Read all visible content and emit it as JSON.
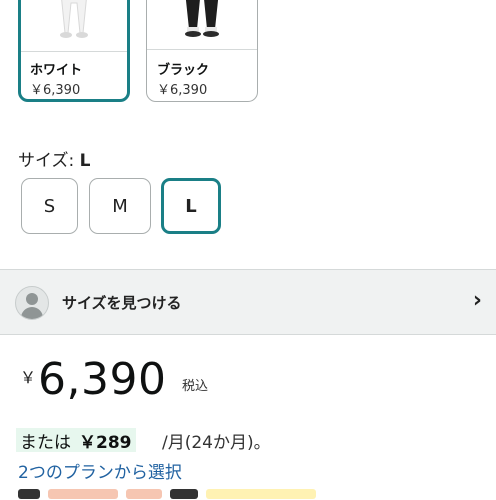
{
  "colors_section": {
    "swatches": [
      {
        "name": "ホワイト",
        "price": "￥6,390",
        "selected": true
      },
      {
        "name": "ブラック",
        "price": "￥6,390",
        "selected": false
      }
    ]
  },
  "size_section": {
    "label_prefix": "サイズ: ",
    "selected_value": "L",
    "options": [
      "S",
      "M",
      "L"
    ]
  },
  "find_size": {
    "label": "サイズを見つける"
  },
  "price": {
    "currency_symbol": "￥",
    "amount": "6,390",
    "tax_note": "税込"
  },
  "installment": {
    "prefix": "または",
    "amount": "￥289",
    "suffix": "/月(24か月)。",
    "plan_link": "2つのプランから選択"
  },
  "theme": {
    "accent": "#1a7f86",
    "link": "#2162a1",
    "installment_bg": "#e7f7ee"
  }
}
